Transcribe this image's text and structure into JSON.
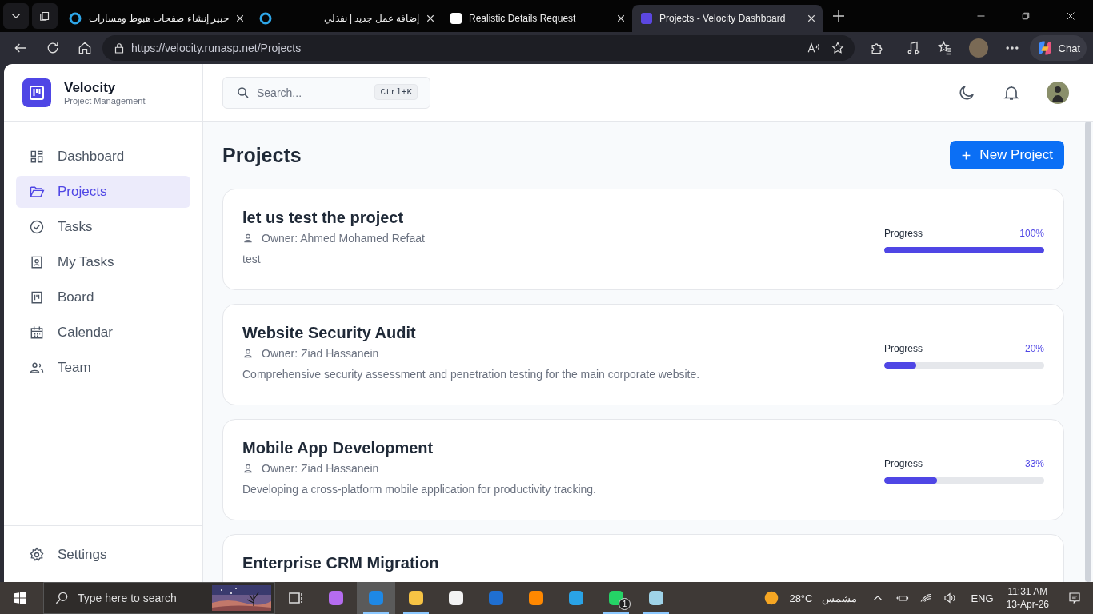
{
  "browser": {
    "tabs": [
      {
        "title": "خبير إنشاء صفحات هبوط ومسارات",
        "selected": false
      },
      {
        "title": "إضافة عمل جديد | نفذلي",
        "selected": false
      },
      {
        "title": "Realistic Details Request",
        "selected": false
      },
      {
        "title": "Projects - Velocity Dashboard",
        "selected": true
      }
    ],
    "address": "https://velocity.runasp.net/Projects",
    "copilot_label": "Chat"
  },
  "sidebar": {
    "brand": "Velocity",
    "tagline": "Project Management",
    "items": [
      {
        "label": "Dashboard",
        "selected": false
      },
      {
        "label": "Projects",
        "selected": true
      },
      {
        "label": "Tasks",
        "selected": false
      },
      {
        "label": "My Tasks",
        "selected": false
      },
      {
        "label": "Board",
        "selected": false
      },
      {
        "label": "Calendar",
        "selected": false
      },
      {
        "label": "Team",
        "selected": false
      }
    ],
    "footer_item": "Settings"
  },
  "header": {
    "search": {
      "placeholder": "Search...",
      "shortcut": "Ctrl+K"
    }
  },
  "page": {
    "title": "Projects",
    "new_button": "New Project",
    "projects": [
      {
        "name": "let us test the project",
        "owner": "Owner: Ahmed Mohamed Refaat",
        "description": "test",
        "progress_label": "Progress",
        "reading": "100%",
        "level": 1.0
      },
      {
        "name": "Website Security Audit",
        "owner": "Owner: Ziad Hassanein",
        "description": "Comprehensive security assessment and penetration testing for the main corporate website.",
        "progress_label": "Progress",
        "reading": "20%",
        "level": 0.2
      },
      {
        "name": "Mobile App Development",
        "owner": "Owner: Ziad Hassanein",
        "description": "Developing a cross-platform mobile application for productivity tracking.",
        "progress_label": "Progress",
        "reading": "33%",
        "level": 0.33
      },
      {
        "name": "Enterprise CRM Migration"
      }
    ]
  },
  "taskbar": {
    "search_placeholder": "Type here to search",
    "apps": [
      {
        "running": false,
        "selected": false
      },
      {
        "running": false,
        "selected": false
      },
      {
        "running": true,
        "selected": true
      },
      {
        "running": true,
        "selected": false
      },
      {
        "running": false,
        "selected": false
      },
      {
        "running": false,
        "selected": false
      },
      {
        "running": false,
        "selected": false
      },
      {
        "running": false,
        "selected": false
      },
      {
        "running": true,
        "selected": false
      },
      {
        "running": true,
        "selected": false
      }
    ],
    "badge": "1",
    "weather": {
      "temperature": "28°C",
      "condition": "مشمس"
    },
    "language": "ENG",
    "time": "11:31 AM",
    "date": "13-Apr-26"
  }
}
